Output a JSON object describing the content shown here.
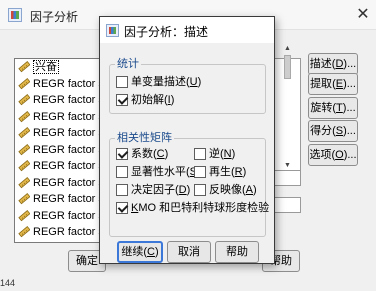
{
  "bg_window": {
    "title": "因子分析",
    "close_glyph": "✕",
    "variables": [
      {
        "label": "兴奋",
        "selected": true
      },
      {
        "label": "REGR factor s",
        "selected": false
      },
      {
        "label": "REGR factor s",
        "selected": false
      },
      {
        "label": "REGR factor s",
        "selected": false
      },
      {
        "label": "REGR factor s",
        "selected": false
      },
      {
        "label": "REGR factor s",
        "selected": false
      },
      {
        "label": "REGR factor s",
        "selected": false
      },
      {
        "label": "REGR factor s",
        "selected": false
      },
      {
        "label": "REGR factor s",
        "selected": false
      },
      {
        "label": "REGR factor s",
        "selected": false
      },
      {
        "label": "REGR factor s",
        "selected": false
      }
    ],
    "side_buttons": {
      "describe": {
        "text": "描述",
        "key": "D",
        "tail": "..."
      },
      "extract": {
        "text": "提取",
        "key": "E",
        "tail": "..."
      },
      "rotate": {
        "text": "旋转",
        "key": "T",
        "tail": "..."
      },
      "scores": {
        "text": "得分",
        "key": "S",
        "tail": "..."
      },
      "options": {
        "text": "选项",
        "key": "O",
        "tail": "..."
      }
    },
    "bottom_buttons": {
      "ok": "确定",
      "help": "帮助"
    },
    "corner_text": "144"
  },
  "dialog": {
    "title": "因子分析：描述",
    "statistics_group": {
      "label": "统计",
      "items": [
        {
          "text": "单变量描述",
          "key": "U",
          "checked": false
        },
        {
          "text": "初始解",
          "key": "I",
          "checked": true
        }
      ]
    },
    "correlation_group": {
      "label": "相关性矩阵",
      "items": [
        {
          "text": "系数",
          "key": "C",
          "checked": true
        },
        {
          "text": "逆",
          "key": "N",
          "checked": false
        },
        {
          "text": "显著性水平",
          "key": "S",
          "checked": false
        },
        {
          "text": "再生",
          "key": "R",
          "checked": false
        },
        {
          "text": "决定因子",
          "key": "D",
          "checked": false
        },
        {
          "text": "反映像",
          "key": "A",
          "checked": false
        }
      ],
      "kmo": {
        "key": "K",
        "text": "MO 和巴特利特球形度检验",
        "checked": true
      }
    },
    "buttons": {
      "continue": {
        "text": "继续",
        "key": "C"
      },
      "cancel": "取消",
      "help": "帮助"
    }
  },
  "colors": {
    "accent": "#3b78d8",
    "group_label": "#1a4a8c"
  }
}
